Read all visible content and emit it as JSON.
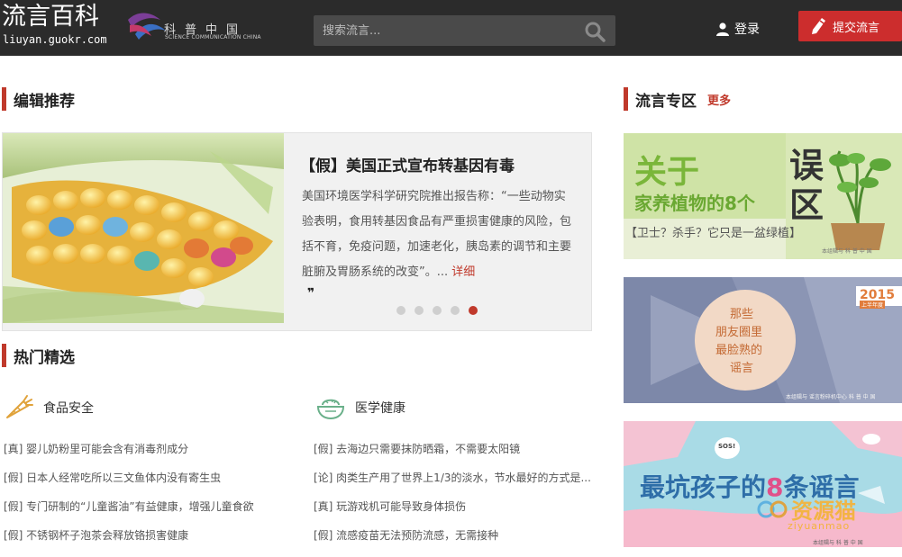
{
  "header": {
    "logo_text": "流言百科",
    "logo_url_text": "liuyan.guokr.com",
    "partner_cn": "科普中国",
    "partner_en": "SCIENCE COMMUNICATION CHINA",
    "search_placeholder": "搜索流言...",
    "login_label": "登录",
    "submit_label": "提交流言"
  },
  "editor_pick": {
    "section_title": "编辑推荐",
    "title": "【假】美国正式宣布转基因有毒",
    "description": "美国环境医学科学研究院推出报告称：“一些动物实验表明，食用转基因食品有严重损害健康的风险，包括不育，免疫问题，加速老化，胰岛素的调节和主要脏腑及胃肠系统的改变”。...",
    "more_label": "详细",
    "slides_total": 5,
    "active_slide": 5
  },
  "hot": {
    "section_title": "热门精选",
    "columns": [
      {
        "category": "食品安全",
        "items": [
          "[真] 婴儿奶粉里可能会含有消毒剂成分",
          "[假] 日本人经常吃所以三文鱼体内没有寄生虫",
          "[假] 专门研制的“儿童酱油”有益健康，增强儿童食欲",
          "[假] 不锈钢杯子泡茶会释放铬损害健康"
        ]
      },
      {
        "category": "医学健康",
        "items": [
          "[假] 去海边只需要抹防晒霜，不需要太阳镜",
          "[论] 肉类生产用了世界上1/3的淡水，节水最好的方式是...",
          "[真] 玩游戏机可能导致身体损伤",
          "[假] 流感疫苗无法预防流感，无需接种"
        ]
      }
    ]
  },
  "special": {
    "section_title": "流言专区",
    "more_label": "更多",
    "tiles": [
      {
        "line1": "关于",
        "line2": "家养植物的8个",
        "big": "误区",
        "caption": "【卫士？杀手？它只是一盆绿植】",
        "footer": "本组辑与  科 普 中 国"
      },
      {
        "poem": [
          "那些",
          "朋友圈里",
          "最脸熟的",
          "谣言"
        ],
        "year": "2015",
        "year_sub": "上半年度",
        "footer": "本组辑与  谣言粉碎机中心  科 普 中 国"
      },
      {
        "title_a": "最坑孩子的",
        "title_b": "8",
        "title_c": "条谣言",
        "badge": "SOS!",
        "footer": "本组辑与  科 普 中 国",
        "watermark": "资源猫",
        "watermark_url": "ziyuanmao"
      }
    ]
  },
  "colors": {
    "accent": "#c0392b",
    "header_bg": "#2b2b2b"
  }
}
